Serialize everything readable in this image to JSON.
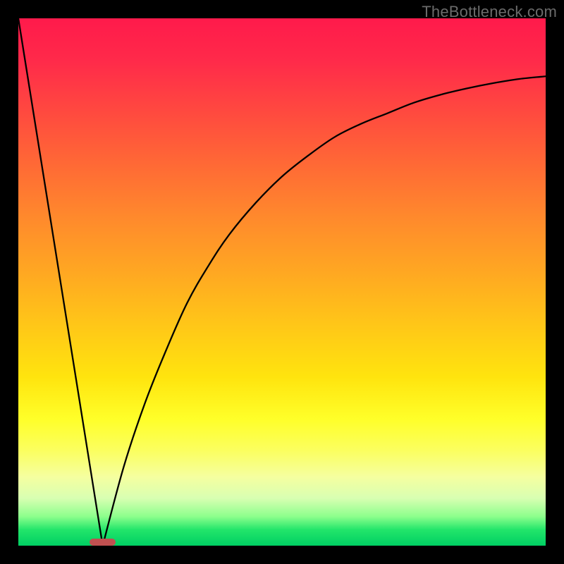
{
  "watermark": "TheBottleneck.com",
  "chart_data": {
    "type": "line",
    "title": "",
    "xlabel": "",
    "ylabel": "",
    "xlim": [
      0,
      100
    ],
    "ylim": [
      0,
      100
    ],
    "grid": false,
    "legend": false,
    "series": [
      {
        "name": "left-branch",
        "x": [
          0,
          16
        ],
        "values": [
          100,
          0
        ]
      },
      {
        "name": "right-branch",
        "x": [
          16,
          20,
          24,
          28,
          32,
          36,
          40,
          45,
          50,
          55,
          60,
          65,
          70,
          75,
          80,
          85,
          90,
          95,
          100
        ],
        "values": [
          0,
          15,
          27,
          37,
          46,
          53,
          59,
          65,
          70,
          74,
          77.5,
          80,
          82,
          84,
          85.5,
          86.7,
          87.7,
          88.5,
          89
        ]
      }
    ],
    "marker": {
      "name": "bottleneck-marker",
      "x_center": 16,
      "width_pct": 5,
      "color": "#c05050"
    },
    "gradient_stops": [
      {
        "pct": 0,
        "color": "#ff1a4b"
      },
      {
        "pct": 18,
        "color": "#ff4a3f"
      },
      {
        "pct": 38,
        "color": "#ff8a2c"
      },
      {
        "pct": 58,
        "color": "#ffc618"
      },
      {
        "pct": 76,
        "color": "#ffff29"
      },
      {
        "pct": 91,
        "color": "#d8ffb2"
      },
      {
        "pct": 100,
        "color": "#00cf63"
      }
    ]
  }
}
